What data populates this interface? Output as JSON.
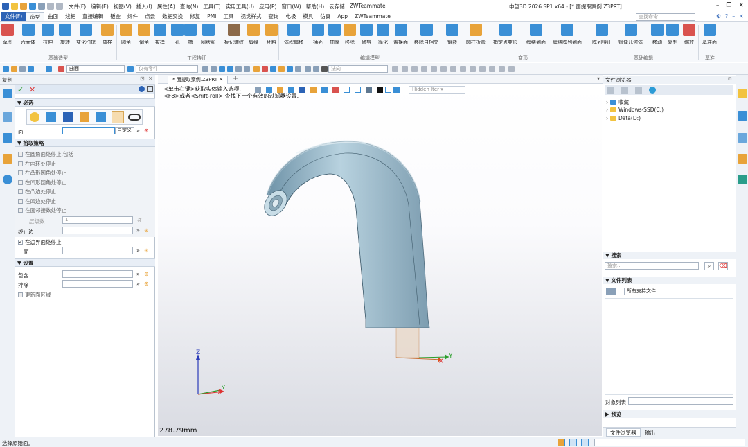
{
  "window": {
    "title": "中望3D 2026 SP1 x64 - [* 面提取案例.Z3PRT]",
    "menus": [
      "文件(F)",
      "编辑(E)",
      "视图(V)",
      "插入(I)",
      "属性(A)",
      "查询(N)",
      "工具(T)",
      "实用工具(U)",
      "应用(P)",
      "窗口(W)",
      "帮助(H)",
      "云存储",
      "ZWTeammate"
    ]
  },
  "ribbon_tabs": [
    "文件(F)",
    "造型",
    "曲面",
    "线框",
    "直接编辑",
    "钣金",
    "焊件",
    "点云",
    "数据交换",
    "修复",
    "PMI",
    "工具",
    "视觉样式",
    "查询",
    "电极",
    "模具",
    "仿真",
    "App",
    "ZWTeammate"
  ],
  "active_tab": "造型",
  "command_search_placeholder": "查找命令",
  "ribbon_buttons": [
    {
      "label": "草图",
      "icon": "sketch-icon",
      "color": "#d9534f"
    },
    {
      "label": "六面体",
      "icon": "box-icon",
      "color": "#3a8fd6"
    },
    {
      "label": "拉伸",
      "icon": "extrude-icon",
      "color": "#3a8fd6"
    },
    {
      "label": "旋转",
      "icon": "revolve-icon",
      "color": "#3a8fd6"
    },
    {
      "label": "变化扫掠",
      "icon": "sweep-icon",
      "color": "#3a8fd6"
    },
    {
      "label": "放样",
      "icon": "loft-icon",
      "color": "#e8a33a"
    },
    {
      "label": "圆角",
      "icon": "fillet-icon",
      "color": "#e8a33a"
    },
    {
      "label": "倒角",
      "icon": "chamfer-icon",
      "color": "#e8a33a"
    },
    {
      "label": "拔模",
      "icon": "draft-icon",
      "color": "#3a8fd6"
    },
    {
      "label": "孔",
      "icon": "hole-icon",
      "color": "#3a8fd6"
    },
    {
      "label": "槽",
      "icon": "slot-icon",
      "color": "#3a8fd6"
    },
    {
      "label": "网状筋",
      "icon": "rib-icon",
      "color": "#3a8fd6"
    },
    {
      "label": "标记螺纹",
      "icon": "thread-icon",
      "color": "#8c6a4a"
    },
    {
      "label": "唇缘",
      "icon": "lip-icon",
      "color": "#e8a33a"
    },
    {
      "label": "坯料",
      "icon": "stock-icon",
      "color": "#e8a33a"
    },
    {
      "label": "体积偏移",
      "icon": "offset-icon",
      "color": "#3a8fd6"
    },
    {
      "label": "抽壳",
      "icon": "shell-icon",
      "color": "#3a8fd6"
    },
    {
      "label": "加厚",
      "icon": "thicken-icon",
      "color": "#3a8fd6"
    },
    {
      "label": "移除",
      "icon": "remove-icon",
      "color": "#e8a33a"
    },
    {
      "label": "修剪",
      "icon": "trim-icon",
      "color": "#3a8fd6"
    },
    {
      "label": "简化",
      "icon": "simplify-icon",
      "color": "#3a8fd6"
    },
    {
      "label": "置换面",
      "icon": "replace-face-icon",
      "color": "#3a8fd6"
    },
    {
      "label": "移除自相交",
      "icon": "self-intersect-icon",
      "color": "#3a8fd6"
    },
    {
      "label": "镶嵌",
      "icon": "emboss-icon",
      "color": "#3a8fd6"
    },
    {
      "label": "圆柱折弯",
      "icon": "cyl-bend-icon",
      "color": "#e8a33a"
    },
    {
      "label": "指定点变形",
      "icon": "point-deform-icon",
      "color": "#3a8fd6"
    },
    {
      "label": "缠绕到面",
      "icon": "wrap-icon",
      "color": "#3a8fd6"
    },
    {
      "label": "缠绕阵列到面",
      "icon": "wrap-pattern-icon",
      "color": "#3a8fd6"
    },
    {
      "label": "阵列特征",
      "icon": "pattern-icon",
      "color": "#3a8fd6"
    },
    {
      "label": "镜像几何体",
      "icon": "mirror-icon",
      "color": "#3a8fd6"
    },
    {
      "label": "移动",
      "icon": "move-icon",
      "color": "#3a8fd6"
    },
    {
      "label": "复制",
      "icon": "copy-icon",
      "color": "#3a8fd6"
    },
    {
      "label": "缩放",
      "icon": "scale-icon",
      "color": "#d9534f"
    },
    {
      "label": "基准面",
      "icon": "datum-plane-icon",
      "color": "#3a8fd6"
    }
  ],
  "ribbon_groups": [
    "基础造型",
    "工程特征",
    "编辑模型",
    "变形",
    "基础编辑",
    "基准"
  ],
  "toolbar2": {
    "filter_value": "曲面",
    "part_value": "仅有零件",
    "direction_value": "法向",
    "render_mode": "Hidden Iter"
  },
  "left_panel": {
    "title": "复制",
    "required_section": "必选",
    "face_label": "面",
    "custom_label": "自定义",
    "pick_strategy_section": "拾取策略",
    "pick_options": [
      "在圆角面处停止,包括",
      "在内环处停止",
      "在凸形圆角处停止",
      "在凹形圆角处停止",
      "在凸边处停止",
      "在凹边处停止",
      "在面邻接数处停止"
    ],
    "layers_label": "层级数",
    "layers_value": "1",
    "stop_edge_label": "终止边",
    "boundary_stop_label": "在边界面处停止",
    "face_label2": "面",
    "settings_section": "设置",
    "include_label": "包含",
    "exclude_label": "排除",
    "update_label": "更新面区域"
  },
  "document_tab": "* 面提取案例.Z3PRT",
  "viewport": {
    "hint1": "<单击右键>获取实体输入选项.",
    "hint2": "<F8>或者<Shift-roll> 查找下一个有效的过滤器设置.",
    "scale_text": "278.79mm",
    "axis_z": "Z",
    "axis_y": "Y",
    "axis_x": "X"
  },
  "file_browser": {
    "title": "文件浏览器",
    "tree": [
      "收藏",
      "Windows-SSD(C:)",
      "Data(D:)"
    ],
    "search_section": "搜索",
    "search_placeholder": "搜索...",
    "file_list_section": "文件列表",
    "file_type": "所有支持文件",
    "object_list_label": "对象列表",
    "preview_label": "预览",
    "bottom_tabs": [
      "文件浏览器",
      "输出"
    ]
  },
  "status_text": "选择原始面。"
}
